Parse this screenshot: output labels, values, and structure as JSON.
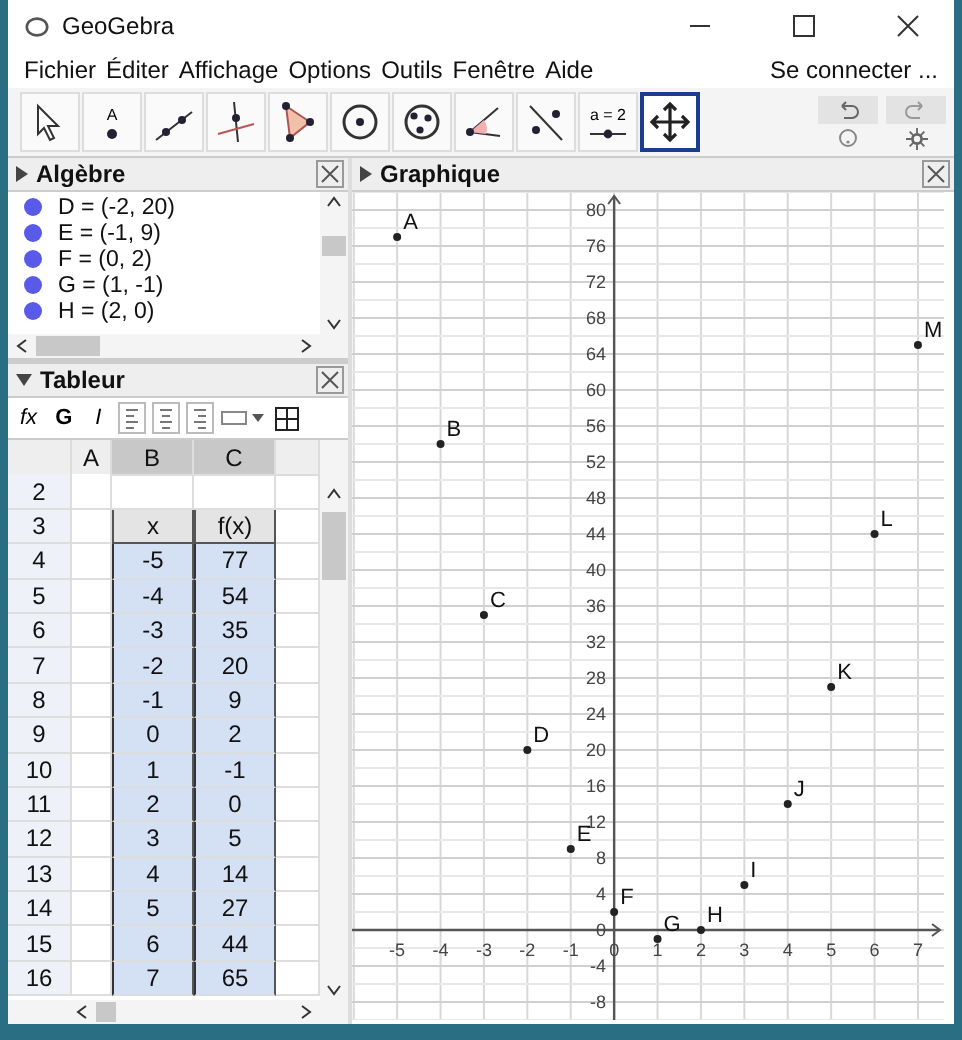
{
  "window": {
    "title": "GeoGebra"
  },
  "menu": {
    "items": [
      "Fichier",
      "Éditer",
      "Affichage",
      "Options",
      "Outils",
      "Fenêtre",
      "Aide"
    ],
    "sign_in": "Se connecter ..."
  },
  "toolbar": {
    "tools": [
      {
        "kind": "pointer",
        "selected": false
      },
      {
        "kind": "point",
        "selected": false,
        "label": "A"
      },
      {
        "kind": "line",
        "selected": false
      },
      {
        "kind": "perpendicular",
        "selected": false
      },
      {
        "kind": "polygon",
        "selected": false
      },
      {
        "kind": "circle",
        "selected": false
      },
      {
        "kind": "circle3",
        "selected": false
      },
      {
        "kind": "angle",
        "selected": false
      },
      {
        "kind": "reflect",
        "selected": false
      },
      {
        "kind": "slider",
        "selected": false,
        "label": "a = 2"
      },
      {
        "kind": "move",
        "selected": true
      }
    ]
  },
  "algebra": {
    "title": "Algèbre",
    "items": [
      "D = (-2, 20)",
      "E = (-1, 9)",
      "F = (0, 2)",
      "G = (1, -1)",
      "H = (2, 0)"
    ]
  },
  "spreadsheet": {
    "title": "Tableur",
    "format_buttons": [
      "fx",
      "G",
      "I"
    ],
    "columns": [
      {
        "label": "A",
        "selected": false
      },
      {
        "label": "B",
        "selected": true
      },
      {
        "label": "C",
        "selected": true
      },
      {
        "selected": false
      }
    ],
    "rows": [
      {
        "label": "2",
        "kind": "blank",
        "cells": []
      },
      {
        "label": "3",
        "kind": "header",
        "cells": [
          "",
          "x",
          "f(x)"
        ]
      },
      {
        "label": "4",
        "kind": "data",
        "cells": [
          "",
          "-5",
          "77"
        ]
      },
      {
        "label": "5",
        "kind": "data",
        "cells": [
          "",
          "-4",
          "54"
        ]
      },
      {
        "label": "6",
        "kind": "data",
        "cells": [
          "",
          "-3",
          "35"
        ]
      },
      {
        "label": "7",
        "kind": "data",
        "cells": [
          "",
          "-2",
          "20"
        ]
      },
      {
        "label": "8",
        "kind": "data",
        "cells": [
          "",
          "-1",
          "9"
        ]
      },
      {
        "label": "9",
        "kind": "data",
        "cells": [
          "",
          "0",
          "2"
        ]
      },
      {
        "label": "10",
        "kind": "data",
        "cells": [
          "",
          "1",
          "-1"
        ]
      },
      {
        "label": "11",
        "kind": "data",
        "cells": [
          "",
          "2",
          "0"
        ]
      },
      {
        "label": "12",
        "kind": "data",
        "cells": [
          "",
          "3",
          "5"
        ]
      },
      {
        "label": "13",
        "kind": "data",
        "cells": [
          "",
          "4",
          "14"
        ]
      },
      {
        "label": "14",
        "kind": "data",
        "cells": [
          "",
          "5",
          "27"
        ]
      },
      {
        "label": "15",
        "kind": "data",
        "cells": [
          "",
          "6",
          "44"
        ]
      },
      {
        "label": "16",
        "kind": "data",
        "cells": [
          "",
          "7",
          "65"
        ]
      }
    ]
  },
  "graphics": {
    "title": "Graphique",
    "chart_data": {
      "type": "scatter",
      "x": [
        -5,
        -4,
        -3,
        -2,
        -1,
        0,
        1,
        2,
        3,
        4,
        5,
        6,
        7
      ],
      "series": [
        {
          "color": "#222222",
          "values": [
            77,
            54,
            35,
            20,
            9,
            2,
            -1,
            0,
            5,
            14,
            27,
            44,
            65
          ]
        }
      ],
      "xlim": [
        -6.04,
        7.6
      ],
      "ylim": [
        -10,
        82
      ],
      "grid": true,
      "xticks": [
        -5,
        -4,
        -3,
        -2,
        -1,
        {
          "value": 0,
          "label": "0"
        },
        1,
        2,
        3,
        4,
        5,
        6,
        7
      ],
      "yticks": [
        -8,
        -4,
        0,
        4,
        8,
        12,
        16,
        20,
        24,
        28,
        32,
        36,
        40,
        44,
        48,
        52,
        56,
        60,
        64,
        68,
        72,
        76,
        80
      ],
      "annotations": [
        {
          "x": -5,
          "y": 77,
          "text": "A"
        },
        {
          "x": -4,
          "y": 54,
          "text": "B"
        },
        {
          "x": -3,
          "y": 35,
          "text": "C"
        },
        {
          "x": -2,
          "y": 20,
          "text": "D"
        },
        {
          "x": -1,
          "y": 9,
          "text": "E"
        },
        {
          "x": 0,
          "y": 2,
          "text": "F"
        },
        {
          "x": 1,
          "y": -1,
          "text": "G"
        },
        {
          "x": 2,
          "y": 0,
          "text": "H"
        },
        {
          "x": 3,
          "y": 5,
          "text": "I"
        },
        {
          "x": 4,
          "y": 14,
          "text": "J"
        },
        {
          "x": 5,
          "y": 27,
          "text": "K"
        },
        {
          "x": 6,
          "y": 44,
          "text": "L"
        },
        {
          "x": 7,
          "y": 65,
          "text": "M"
        }
      ]
    }
  }
}
